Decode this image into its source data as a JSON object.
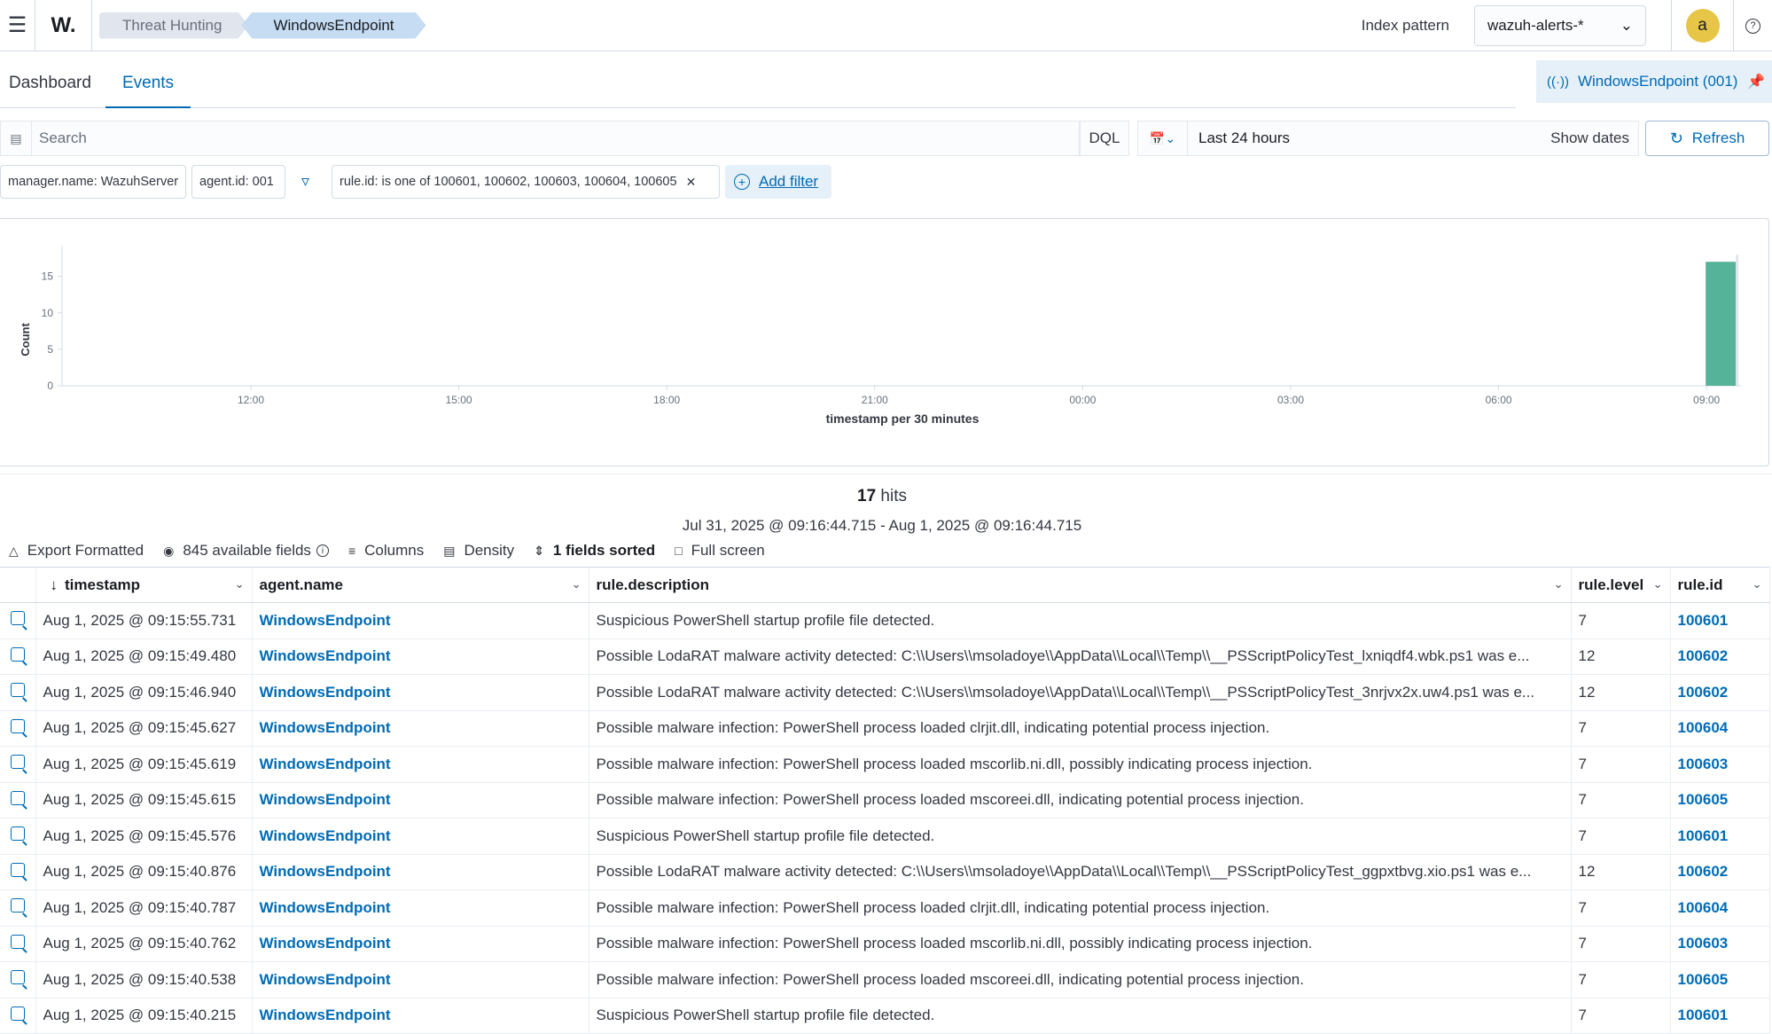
{
  "header": {
    "menu_icon": "hamburger-icon",
    "logo_text": "W.",
    "breadcrumbs": [
      "Threat Hunting",
      "WindowsEndpoint"
    ],
    "index_pattern_label": "Index pattern",
    "index_pattern_value": "wazuh-alerts-*",
    "avatar_letter": "a",
    "help_icon": "?"
  },
  "tabs": [
    {
      "label": "Dashboard",
      "active": false
    },
    {
      "label": "Events",
      "active": true
    }
  ],
  "agent_pill": {
    "label": "WindowsEndpoint (001)"
  },
  "search": {
    "placeholder": "Search",
    "language": "DQL",
    "time_range": "Last 24 hours",
    "show_dates": "Show dates",
    "refresh": "Refresh"
  },
  "filters": {
    "pills": [
      "manager.name: WazuhServer",
      "agent.id: 001",
      "rule.id: is one of 100601, 100602, 100603, 100604, 100605"
    ],
    "add_filter": "Add filter"
  },
  "chart_data": {
    "type": "bar",
    "x": [
      "09:00"
    ],
    "values": [
      17
    ],
    "xticks": [
      "12:00",
      "15:00",
      "18:00",
      "21:00",
      "00:00",
      "03:00",
      "06:00",
      "09:00"
    ],
    "yticks": [
      0,
      5,
      10,
      15
    ],
    "ylim": [
      0,
      18
    ],
    "ylabel": "Count",
    "xlabel": "timestamp per 30 minutes",
    "bar_color": "#54b399"
  },
  "results": {
    "hits_count": "17",
    "hits_word": "hits",
    "date_range": "Jul 31, 2025 @ 09:16:44.715 - Aug 1, 2025 @ 09:16:44.715",
    "toolbar": {
      "export": "Export Formatted",
      "fields": "845 available fields",
      "columns": "Columns",
      "density": "Density",
      "sorted": "1 fields sorted",
      "fullscreen": "Full screen"
    },
    "columns": [
      "timestamp",
      "agent.name",
      "rule.description",
      "rule.level",
      "rule.id"
    ],
    "rows": [
      {
        "timestamp": "Aug 1, 2025 @ 09:15:55.731",
        "agent": "WindowsEndpoint",
        "description": "Suspicious PowerShell startup profile file detected.",
        "level": "7",
        "rule_id": "100601"
      },
      {
        "timestamp": "Aug 1, 2025 @ 09:15:49.480",
        "agent": "WindowsEndpoint",
        "description": "Possible LodaRAT malware activity detected: C:\\\\Users\\\\msoladoye\\\\AppData\\\\Local\\\\Temp\\\\__PSScriptPolicyTest_lxniqdf4.wbk.ps1 was e...",
        "level": "12",
        "rule_id": "100602"
      },
      {
        "timestamp": "Aug 1, 2025 @ 09:15:46.940",
        "agent": "WindowsEndpoint",
        "description": "Possible LodaRAT malware activity detected: C:\\\\Users\\\\msoladoye\\\\AppData\\\\Local\\\\Temp\\\\__PSScriptPolicyTest_3nrjvx2x.uw4.ps1 was e...",
        "level": "12",
        "rule_id": "100602"
      },
      {
        "timestamp": "Aug 1, 2025 @ 09:15:45.627",
        "agent": "WindowsEndpoint",
        "description": "Possible malware infection: PowerShell process loaded clrjit.dll, indicating potential process injection.",
        "level": "7",
        "rule_id": "100604"
      },
      {
        "timestamp": "Aug 1, 2025 @ 09:15:45.619",
        "agent": "WindowsEndpoint",
        "description": "Possible malware infection: PowerShell process loaded mscorlib.ni.dll, possibly indicating process injection.",
        "level": "7",
        "rule_id": "100603"
      },
      {
        "timestamp": "Aug 1, 2025 @ 09:15:45.615",
        "agent": "WindowsEndpoint",
        "description": "Possible malware infection: PowerShell process loaded mscoreei.dll, indicating potential process injection.",
        "level": "7",
        "rule_id": "100605"
      },
      {
        "timestamp": "Aug 1, 2025 @ 09:15:45.576",
        "agent": "WindowsEndpoint",
        "description": "Suspicious PowerShell startup profile file detected.",
        "level": "7",
        "rule_id": "100601"
      },
      {
        "timestamp": "Aug 1, 2025 @ 09:15:40.876",
        "agent": "WindowsEndpoint",
        "description": "Possible LodaRAT malware activity detected: C:\\\\Users\\\\msoladoye\\\\AppData\\\\Local\\\\Temp\\\\__PSScriptPolicyTest_ggpxtbvg.xio.ps1 was e...",
        "level": "12",
        "rule_id": "100602"
      },
      {
        "timestamp": "Aug 1, 2025 @ 09:15:40.787",
        "agent": "WindowsEndpoint",
        "description": "Possible malware infection: PowerShell process loaded clrjit.dll, indicating potential process injection.",
        "level": "7",
        "rule_id": "100604"
      },
      {
        "timestamp": "Aug 1, 2025 @ 09:15:40.762",
        "agent": "WindowsEndpoint",
        "description": "Possible malware infection: PowerShell process loaded mscorlib.ni.dll, possibly indicating process injection.",
        "level": "7",
        "rule_id": "100603"
      },
      {
        "timestamp": "Aug 1, 2025 @ 09:15:40.538",
        "agent": "WindowsEndpoint",
        "description": "Possible malware infection: PowerShell process loaded mscoreei.dll, indicating potential process injection.",
        "level": "7",
        "rule_id": "100605"
      },
      {
        "timestamp": "Aug 1, 2025 @ 09:15:40.215",
        "agent": "WindowsEndpoint",
        "description": "Suspicious PowerShell startup profile file detected.",
        "level": "7",
        "rule_id": "100601"
      }
    ]
  },
  "colors": {
    "accent": "#006bb4",
    "bar": "#54b399",
    "avatar": "#e7c547"
  }
}
